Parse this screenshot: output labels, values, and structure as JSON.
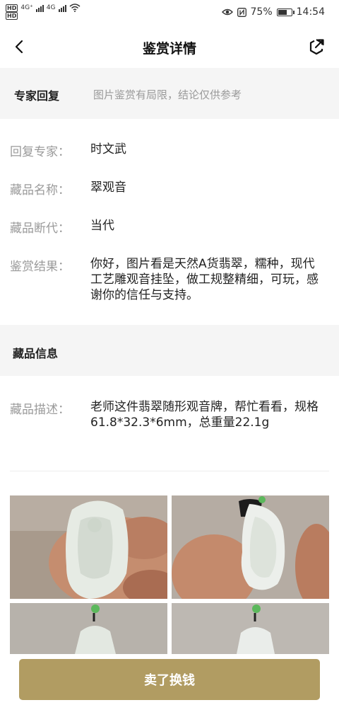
{
  "status_bar": {
    "hd1": "HD",
    "network1": "4G⁺",
    "network2": "4G",
    "hd2": "HD",
    "battery_percent": "75%",
    "battery_level": 0.75,
    "time": "14:54"
  },
  "header": {
    "title": "鉴赏详情",
    "back_icon": "chevron-left-icon",
    "share_icon": "share-icon"
  },
  "expert_section": {
    "title": "专家回复",
    "note": "图片鉴赏有局限，结论仅供参考"
  },
  "reply_fields": [
    {
      "label": "回复专家：",
      "value": "时文武"
    },
    {
      "label": "藏品名称：",
      "value": "翠观音"
    },
    {
      "label": "藏品断代：",
      "value": "当代"
    },
    {
      "label": "鉴赏结果：",
      "value": "你好，图片看是天然A货翡翠，糯种，现代工艺雕观音挂坠，做工规整精细，可玩，感谢你的信任与支持。"
    }
  ],
  "collection_section": {
    "title": "藏品信息",
    "description_label": "藏品描述：",
    "description_value": "老师这件翡翠随形观音牌，帮忙看看，规格61.8*32.3*6mm，总重量22.1g"
  },
  "bottom_button": {
    "label": "卖了换钱",
    "color": "#b19c62"
  }
}
